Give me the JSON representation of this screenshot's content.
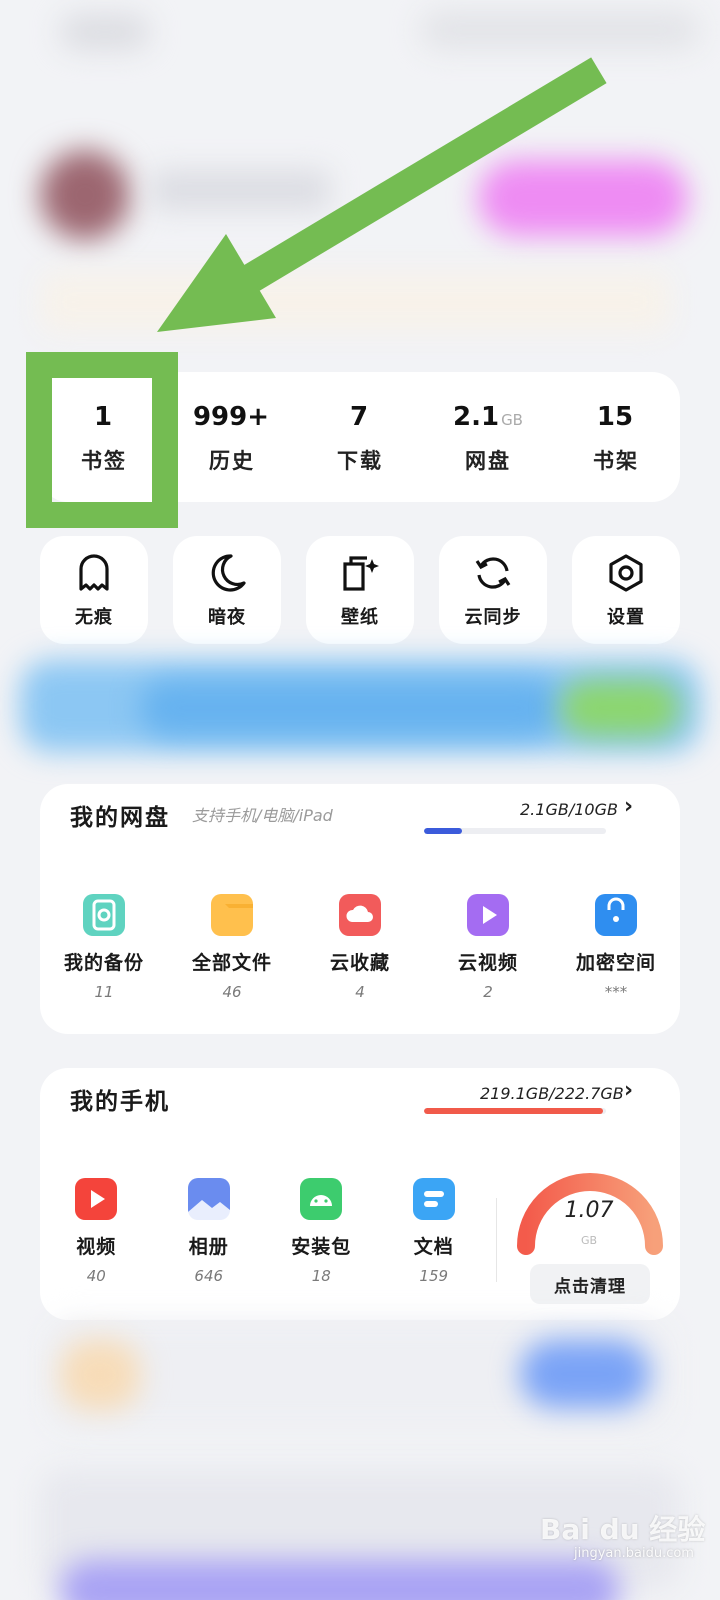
{
  "stats": [
    {
      "value": "1",
      "unit": "",
      "label": "书签"
    },
    {
      "value": "999+",
      "unit": "",
      "label": "历史"
    },
    {
      "value": "7",
      "unit": "",
      "label": "下载"
    },
    {
      "value": "2.1",
      "unit": "GB",
      "label": "网盘"
    },
    {
      "value": "15",
      "unit": "",
      "label": "书架"
    }
  ],
  "quick_actions": [
    {
      "label": "无痕",
      "icon": "ghost-icon"
    },
    {
      "label": "暗夜",
      "icon": "moon-icon"
    },
    {
      "label": "壁纸",
      "icon": "wallpaper-icon"
    },
    {
      "label": "云同步",
      "icon": "sync-icon"
    },
    {
      "label": "设置",
      "icon": "settings-icon"
    }
  ],
  "cloud_card": {
    "title": "我的网盘",
    "subtitle": "支持手机/电脑/iPad",
    "storage": "2.1GB/10GB",
    "usage_fraction": 0.21,
    "bar_color": "#3b5bdb",
    "items": [
      {
        "label": "我的备份",
        "count": "11",
        "icon": "backup-icon",
        "color": "#5fd3c0"
      },
      {
        "label": "全部文件",
        "count": "46",
        "icon": "folder-icon",
        "color": "#ffc04d"
      },
      {
        "label": "云收藏",
        "count": "4",
        "icon": "cloud-favorite-icon",
        "color": "#f25b5b"
      },
      {
        "label": "云视频",
        "count": "2",
        "icon": "cloud-video-icon",
        "color": "#a46cf2"
      },
      {
        "label": "加密空间",
        "count": "***",
        "icon": "lock-icon",
        "color": "#2f8ef0"
      }
    ]
  },
  "phone_card": {
    "title": "我的手机",
    "storage": "219.1GB/222.7GB",
    "usage_fraction": 0.984,
    "bar_color": "#f15a4a",
    "items": [
      {
        "label": "视频",
        "count": "40",
        "icon": "video-icon",
        "color": "#f4443b"
      },
      {
        "label": "相册",
        "count": "646",
        "icon": "album-icon",
        "color": "#6a8cef"
      },
      {
        "label": "安装包",
        "count": "18",
        "icon": "android-package-icon",
        "color": "#3dcc6e"
      },
      {
        "label": "文档",
        "count": "159",
        "icon": "document-icon",
        "color": "#3ba5f5"
      }
    ],
    "gauge_value": "1.07",
    "gauge_unit": "GB",
    "clean_button": "点击清理"
  },
  "watermark": {
    "brand": "Bai du 经验",
    "domain": "jingyan.baidu.com"
  },
  "colors": {
    "annotation_green": "#74bc52",
    "card_bg": "#ffffff",
    "page_bg": "#f2f3f6"
  }
}
